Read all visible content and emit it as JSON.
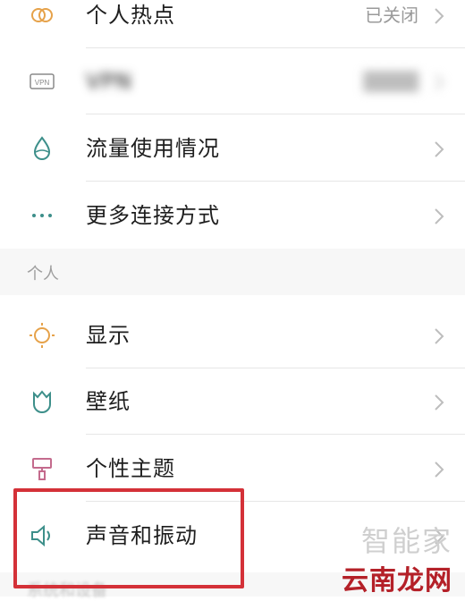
{
  "network_rows": [
    {
      "label": "个人热点",
      "value": "已关闭"
    },
    {
      "label": "VPN",
      "value": "",
      "icon_text": "VPN"
    },
    {
      "label": "流量使用情况"
    },
    {
      "label": "更多连接方式"
    }
  ],
  "section_personal": {
    "title": "个人",
    "rows": [
      {
        "label": "显示"
      },
      {
        "label": "壁纸"
      },
      {
        "label": "个性主题"
      },
      {
        "label": "声音和振动"
      }
    ]
  },
  "next_section": {
    "title": "系统和设备"
  },
  "watermark": {
    "top": "智能家",
    "bottom": "云南龙网"
  },
  "colors": {
    "highlight": "#d43138",
    "icon_orange": "#e6a24a",
    "icon_teal": "#3d8f8a"
  }
}
